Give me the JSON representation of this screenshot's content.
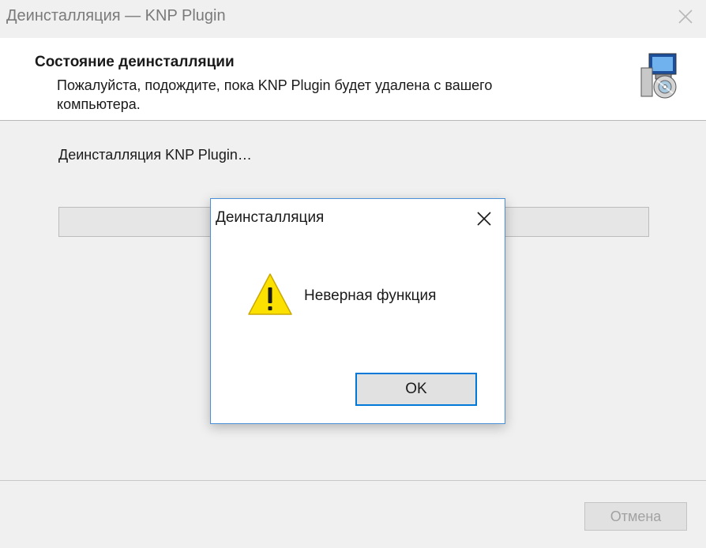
{
  "window": {
    "title": "Деинсталляция — KNP Plugin"
  },
  "header": {
    "title": "Состояние деинсталляции",
    "subtitle": "Пожалуйста, подождите, пока KNP Plugin будет удалена с вашего компьютера.",
    "icon": "installer-computer-cd-icon"
  },
  "main": {
    "status_text": "Деинсталляция KNP Plugin…",
    "progress": 0
  },
  "footer": {
    "cancel_label": "Отмена"
  },
  "dialog": {
    "title": "Деинсталляция",
    "message": "Неверная функция",
    "icon": "warning-icon",
    "ok_label": "OK"
  },
  "colors": {
    "dialog_border": "#4a90d9",
    "ok_focus": "#0078d7",
    "warning": "#fce100"
  }
}
